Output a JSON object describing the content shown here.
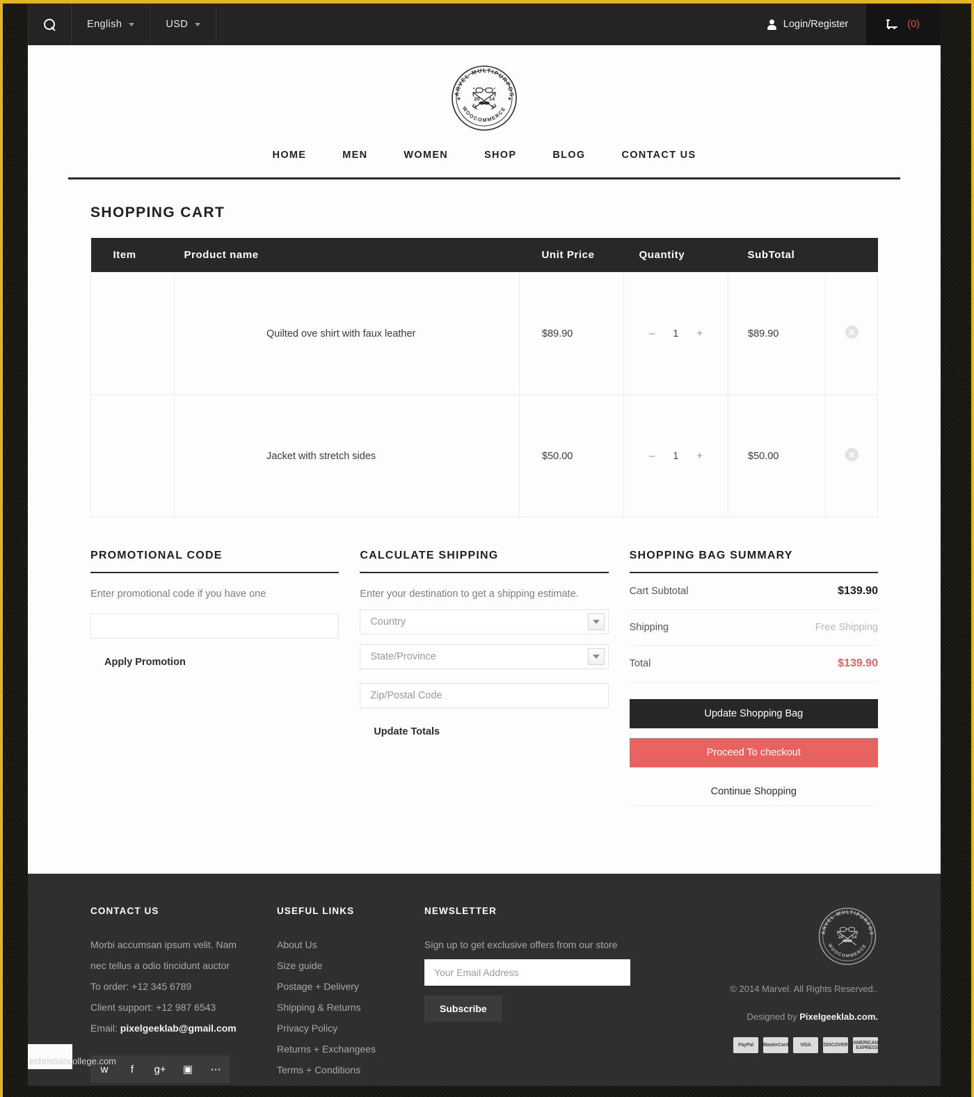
{
  "topbar": {
    "search_icon": "search-icon",
    "language": "English",
    "currency": "USD",
    "login": "Login/Register",
    "cart_count": "(0)"
  },
  "brand": {
    "logo_top_text": "MARVEL MULTIPURPOSE",
    "logo_bottom_text": "WOOCOMMERCE",
    "logo_year_left": "20",
    "logo_year_right": "14"
  },
  "nav": [
    {
      "label": "HOME"
    },
    {
      "label": "MEN"
    },
    {
      "label": "WOMEN"
    },
    {
      "label": "SHOP"
    },
    {
      "label": "BLOG"
    },
    {
      "label": "CONTACT US"
    }
  ],
  "page_title": "SHOPPING CART",
  "cart": {
    "columns": [
      "Item",
      "Product name",
      "Unit Price",
      "Quantity",
      "SubTotal"
    ],
    "rows": [
      {
        "name": "Quilted ove shirt with faux leather",
        "unit_price": "$89.90",
        "qty": "1",
        "minus": "–",
        "plus": "+",
        "subtotal": "$89.90"
      },
      {
        "name": "Jacket with stretch sides",
        "unit_price": "$50.00",
        "qty": "1",
        "minus": "–",
        "plus": "+",
        "subtotal": "$50.00"
      }
    ]
  },
  "promo": {
    "title": "PROMOTIONAL CODE",
    "hint": "Enter promotional code if you have one",
    "input_value": "",
    "input_placeholder": "",
    "apply_label": "Apply Promotion"
  },
  "shipping": {
    "title": "CALCULATE SHIPPING",
    "hint": "Enter your destination to get a shipping estimate.",
    "country": "Country",
    "state": "State/Province",
    "zip_placeholder": "Zip/Postal Code",
    "zip_value": "",
    "update_label": "Update Totals"
  },
  "summary": {
    "title": "SHOPPING BAG SUMMARY",
    "rows": [
      {
        "label": "Cart Subtotal",
        "value": "$139.90"
      },
      {
        "label": "Shipping",
        "value": "Free Shipping"
      },
      {
        "label": "Total",
        "value": "$139.90"
      }
    ],
    "update_button": "Update Shopping Bag",
    "checkout_button": "Proceed To checkout",
    "continue_button": "Continue Shopping"
  },
  "footer": {
    "contact": {
      "title": "CONTACT US",
      "line1": "Morbi accumsan ipsum velit. Nam",
      "line2": "nec tellus a odio tincidunt auctor",
      "order": "To order: +12 345 6789",
      "support": "Client support: +12 987 6543",
      "email_label": "Email:",
      "email": "pixelgeeklab@gmail.com",
      "socials": [
        "twitter-icon",
        "facebook-icon",
        "google-plus-icon",
        "instagram-icon",
        "flickr-icon"
      ]
    },
    "links": {
      "title": "USEFUL LINKS",
      "items": [
        "About Us",
        "Size guide",
        "Postage + Delivery",
        "Shipping & Returns",
        "Privacy Policy",
        "Returns + Exchangees",
        "Terms + Conditions"
      ]
    },
    "newsletter": {
      "title": "NEWSLETTER",
      "hint": "Sign up to get exclusive offers from our store",
      "placeholder": "Your Email Address",
      "value": "",
      "button": "Subscribe"
    },
    "brand": {
      "copyright": "© 2014 Marvel. All Rights Reserved..",
      "designed_prefix": "Designed by ",
      "designed_by": "Pixelgeeklab.com.",
      "payments": [
        "PayPal",
        "MasterCard",
        "VISA",
        "DISCOVER",
        "AMERICAN EXPRESS"
      ]
    }
  },
  "watermark": "echristiancollege.com",
  "colors": {
    "accent_red": "#e8635f",
    "dark": "#272727",
    "gold_border": "#e3b521"
  }
}
